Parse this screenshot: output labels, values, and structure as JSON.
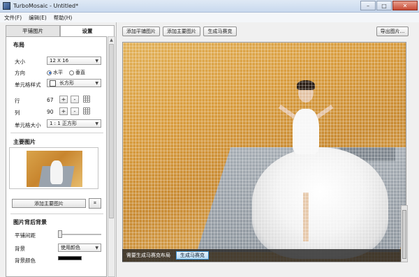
{
  "window": {
    "title": "TurboMosaic - Untitled*",
    "minimize": "–",
    "maximize": "□",
    "close": "✕"
  },
  "menu": [
    "文件(F)",
    "编辑(E)",
    "帮助(H)"
  ],
  "tabs": {
    "tile_images": "平铺图片",
    "settings": "设置"
  },
  "layout_section": {
    "title": "布局",
    "size_label": "大小",
    "size_value": "12 X 16",
    "direction_label": "方向",
    "horizontal": "水平",
    "vertical": "垂直",
    "cell_style_label": "单元格样式",
    "cell_style_value": "长方形",
    "rows_label": "行",
    "rows_value": "67",
    "cols_label": "列",
    "cols_value": "90",
    "plus": "+",
    "minus": "-",
    "cell_size_label": "单元格大小",
    "cell_size_value": "1 : 1 正方形"
  },
  "main_image_section": {
    "title": "主要图片",
    "add_button": "添加主要图片",
    "crop_icon": "crop-icon"
  },
  "background_section": {
    "title": "图片背后背景",
    "tile_spacing_label": "平铺间距",
    "background_label": "背景",
    "background_value": "使用颜色",
    "bg_color_label": "背景颜色",
    "bg_color": "#000000"
  },
  "toolbar": {
    "add_tile": "添加平铺图片",
    "add_main": "添加主要图片",
    "generate": "生成马赛克",
    "export": "导出图片..."
  },
  "status": {
    "message": "需要生成马赛克布局",
    "generate_button": "生成马赛克"
  }
}
